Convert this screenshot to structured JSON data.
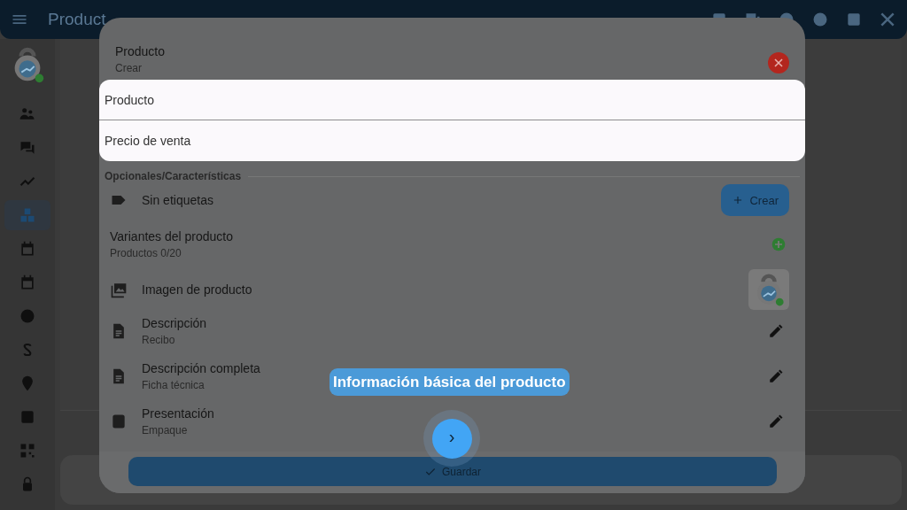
{
  "app_bar": {
    "title": "Product"
  },
  "sidebar": {
    "items": [
      {
        "selected": false
      },
      {
        "selected": false
      },
      {
        "selected": false
      },
      {
        "selected": true
      },
      {
        "selected": false
      },
      {
        "selected": false
      },
      {
        "selected": false
      },
      {
        "selected": false
      },
      {
        "selected": false
      },
      {
        "selected": false
      },
      {
        "selected": false
      },
      {
        "selected": false
      }
    ]
  },
  "dialog": {
    "title": "Producto",
    "subtitle": "Crear",
    "fields": [
      {
        "placeholder": "Producto"
      },
      {
        "placeholder": "Precio de venta"
      }
    ],
    "section": "Opcionales/Características",
    "rows": [
      {
        "kind": "tags",
        "label": "Sin etiquetas",
        "button": "Crear"
      },
      {
        "kind": "variants",
        "label": "Variantes del producto",
        "sublabel": "Productos 0/20"
      },
      {
        "kind": "image",
        "label": "Imagen de producto"
      },
      {
        "kind": "edit",
        "label": "Descripción",
        "sublabel": "Recibo"
      },
      {
        "kind": "edit",
        "label": "Descripción completa",
        "sublabel": "Ficha técnica"
      },
      {
        "kind": "edit",
        "label": "Presentación",
        "sublabel": "Empaque"
      }
    ],
    "save_button": "Guardar"
  },
  "tour": {
    "tooltip": "Información básica del producto",
    "next_button": "›"
  }
}
